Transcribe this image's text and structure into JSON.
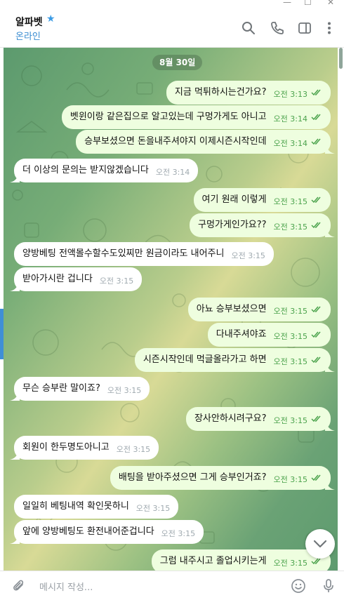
{
  "window": {
    "minimize": "—",
    "maximize": "☐",
    "close": "✕"
  },
  "header": {
    "chat_name": "알파벳",
    "status": "온라인",
    "icons": [
      "search-icon",
      "phone-icon",
      "sidebar-toggle-icon",
      "more-vertical-icon"
    ]
  },
  "chat": {
    "date_chip": "8월 30일",
    "messages": [
      {
        "dir": "out",
        "text": "지금 먹튀하시는건가요?",
        "time": "오전 3:13"
      },
      {
        "dir": "out",
        "text": "벳윈이랑 같은집으로 알고있는데 구멍가게도 아니고",
        "time": "오전 3:14"
      },
      {
        "dir": "out",
        "text": "승부보셨으면 돈을내주셔야지 이제시즌시작인데",
        "time": "오전 3:14"
      },
      {
        "dir": "in",
        "text": "더 이상의 문의는 받지않겠습니다",
        "time": "오전 3:14"
      },
      {
        "dir": "out",
        "text": "여기 원래 이렇게",
        "time": "오전 3:15"
      },
      {
        "dir": "out",
        "text": "구멍가게인가요??",
        "time": "오전 3:15"
      },
      {
        "dir": "in",
        "text": "양방베팅 전액몰수할수도있찌만 원금이라도 내어주니",
        "time": "오전 3:15"
      },
      {
        "dir": "in",
        "text": "받아가시란 겁니다",
        "time": "오전 3:15"
      },
      {
        "dir": "out",
        "text": "아뇨 승부보셨으면",
        "time": "오전 3:15"
      },
      {
        "dir": "out",
        "text": "다내주셔야죠",
        "time": "오전 3:15"
      },
      {
        "dir": "out",
        "text": "시즌시작인데 먹글올라가고 하면",
        "time": "오전 3:15"
      },
      {
        "dir": "in",
        "text": "무슨 승부란 말이죠?",
        "time": "오전 3:15"
      },
      {
        "dir": "out",
        "text": "장사안하시려구요?",
        "time": "오전 3:15"
      },
      {
        "dir": "in",
        "text": "회원이 한두명도아니고",
        "time": "오전 3:15"
      },
      {
        "dir": "out",
        "text": "배팅을 받아주셨으면 그게 승부인거죠?",
        "time": "오전 3:15"
      },
      {
        "dir": "in",
        "text": "일일히 베팅내역 확인못하니",
        "time": "오전 3:15"
      },
      {
        "dir": "in",
        "text": "앞에 양방베팅도 환전내어준겁니다",
        "time": "오전 3:15"
      },
      {
        "dir": "out",
        "text": "그럼 내주시고 졸업시키는게",
        "time": "오전 3:15"
      }
    ]
  },
  "composer": {
    "placeholder": "메시지 작성...",
    "icons": [
      "attach-icon",
      "emoji-icon",
      "microphone-icon"
    ]
  },
  "colors": {
    "out_bubble": "#eefedf",
    "in_bubble": "#ffffff",
    "out_time": "#4ca34d",
    "in_time": "#a0aab0",
    "accent": "#3a8cd1"
  }
}
